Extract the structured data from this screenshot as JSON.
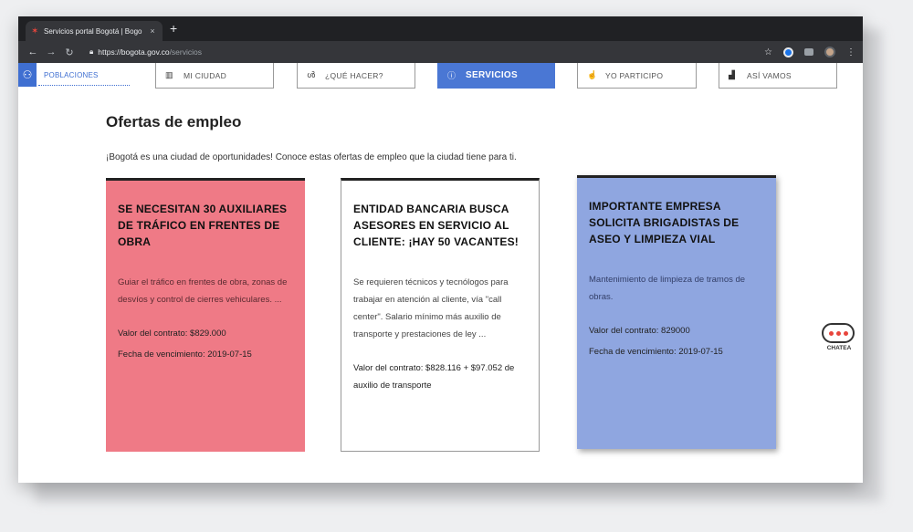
{
  "browser": {
    "tab_title": "Servicios portal Bogotá | Bogo",
    "tab_close": "×",
    "new_tab": "+",
    "url_host": "https://bogota.gov.co",
    "url_path": "/servicios"
  },
  "nav": {
    "poblaciones": "POBLACIONES",
    "tabs": [
      {
        "label": "MI CIUDAD",
        "icon": "building-icon"
      },
      {
        "label": "¿QUÉ HACER?",
        "icon": "bike-icon"
      },
      {
        "label": "SERVICIOS",
        "icon": "info-circle-icon"
      },
      {
        "label": "YO PARTICIPO",
        "icon": "hand-icon"
      },
      {
        "label": "ASÍ VAMOS",
        "icon": "bar-chart-icon"
      }
    ],
    "active_color": "#4a77d4"
  },
  "main": {
    "title": "Ofertas de empleo",
    "intro": "¡Bogotá es una ciudad de oportunidades! Conoce estas ofertas de empleo que la ciudad tiene para ti."
  },
  "cards": [
    {
      "title": "Se necesitan 30 auxiliares de tráfico en frentes de obra",
      "description": "Guiar el tráfico en frentes de obra, zonas de desvíos y control de cierres vehiculares. ...",
      "valor": "Valor del contrato: $829.000",
      "fecha": "Fecha de vencimiento: 2019-07-15",
      "color": "#ef7a86"
    },
    {
      "title": "Entidad bancaria busca asesores en servicio al cliente: ¡hay 50 vacantes!",
      "description": "Se requieren técnicos y tecnólogos para trabajar en atención al cliente, vía \"call center\". Salario mínimo más auxilio de transporte y prestaciones de ley ...",
      "valor": "Valor del contrato: $828.116 + $97.052 de auxilio de transporte",
      "color": "#ffffff"
    },
    {
      "title": "Importante empresa solicita brigadistas de aseo y limpieza vial",
      "description": "Mantenimiento de limpieza de tramos de obras.",
      "valor": "Valor del contrato: 829000",
      "fecha": "Fecha de vencimiento: 2019-07-15",
      "color": "#8fa6e0"
    }
  ],
  "chat": {
    "label": "CHATEA"
  }
}
